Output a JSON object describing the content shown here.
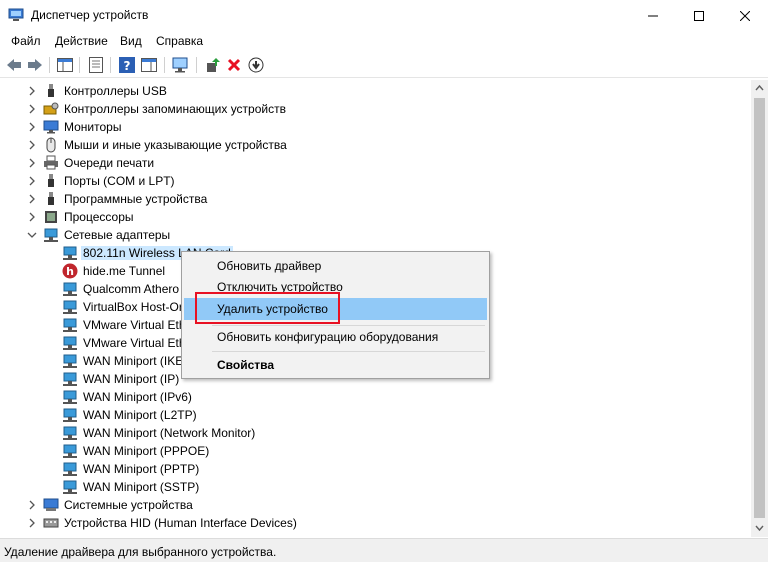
{
  "window": {
    "title": "Диспетчер устройств",
    "app_icon": "device-manager-icon"
  },
  "menu": {
    "items": [
      "Файл",
      "Действие",
      "Вид",
      "Справка"
    ]
  },
  "toolbar": {
    "buttons": [
      "back-arrow-icon",
      "forward-arrow-icon",
      "show-hide-tree-icon",
      "properties-icon",
      "help-icon",
      "action-pane-icon",
      "scan-hardware-icon",
      "update-driver-icon",
      "uninstall-x-icon",
      "disable-device-icon"
    ],
    "uninstall_color": "#e81123"
  },
  "tree": {
    "categories_top": [
      {
        "label": "Контроллеры USB",
        "icon": "usb-icon"
      },
      {
        "label": "Контроллеры запоминающих устройств",
        "icon": "storage-controller-icon"
      },
      {
        "label": "Мониторы",
        "icon": "monitor-icon"
      },
      {
        "label": "Мыши и иные указывающие устройства",
        "icon": "mouse-icon"
      },
      {
        "label": "Очереди печати",
        "icon": "printer-icon"
      },
      {
        "label": "Порты (COM и LPT)",
        "icon": "port-icon"
      },
      {
        "label": "Программные устройства",
        "icon": "software-device-icon"
      },
      {
        "label": "Процессоры",
        "icon": "processor-icon"
      }
    ],
    "network_category": {
      "label": "Сетевые адаптеры",
      "icon": "network-adapter-icon"
    },
    "network_devices": [
      {
        "label": "802.11n Wireless LAN Card",
        "icon": "network-adapter-icon"
      },
      {
        "label": "hide.me Tunnel",
        "icon": "hideme-icon"
      },
      {
        "label": "Qualcomm Athero",
        "icon": "network-adapter-icon"
      },
      {
        "label": "VirtualBox Host-Or",
        "icon": "network-adapter-icon"
      },
      {
        "label": "VMware Virtual Eth",
        "icon": "network-adapter-icon"
      },
      {
        "label": "VMware Virtual Eth",
        "icon": "network-adapter-icon"
      },
      {
        "label": "WAN Miniport (IKE",
        "icon": "network-adapter-icon"
      },
      {
        "label": "WAN Miniport (IP)",
        "icon": "network-adapter-icon"
      },
      {
        "label": "WAN Miniport (IPv6)",
        "icon": "network-adapter-icon"
      },
      {
        "label": "WAN Miniport (L2TP)",
        "icon": "network-adapter-icon"
      },
      {
        "label": "WAN Miniport (Network Monitor)",
        "icon": "network-adapter-icon"
      },
      {
        "label": "WAN Miniport (PPPOE)",
        "icon": "network-adapter-icon"
      },
      {
        "label": "WAN Miniport (PPTP)",
        "icon": "network-adapter-icon"
      },
      {
        "label": "WAN Miniport (SSTP)",
        "icon": "network-adapter-icon"
      }
    ],
    "categories_bottom": [
      {
        "label": "Системные устройства",
        "icon": "system-device-icon"
      },
      {
        "label": "Устройства HID (Human Interface Devices)",
        "icon": "hid-device-icon"
      }
    ]
  },
  "context_menu": {
    "items": [
      {
        "label": "Обновить драйвер"
      },
      {
        "label": "Отключить устройство"
      },
      {
        "label": "Удалить устройство"
      },
      {
        "label": "Обновить конфигурацию оборудования"
      },
      {
        "label": "Свойства"
      }
    ],
    "highlight_color": "#91c9f7",
    "annotation_color": "#e81123"
  },
  "status": {
    "text": "Удаление драйвера для выбранного устройства."
  }
}
